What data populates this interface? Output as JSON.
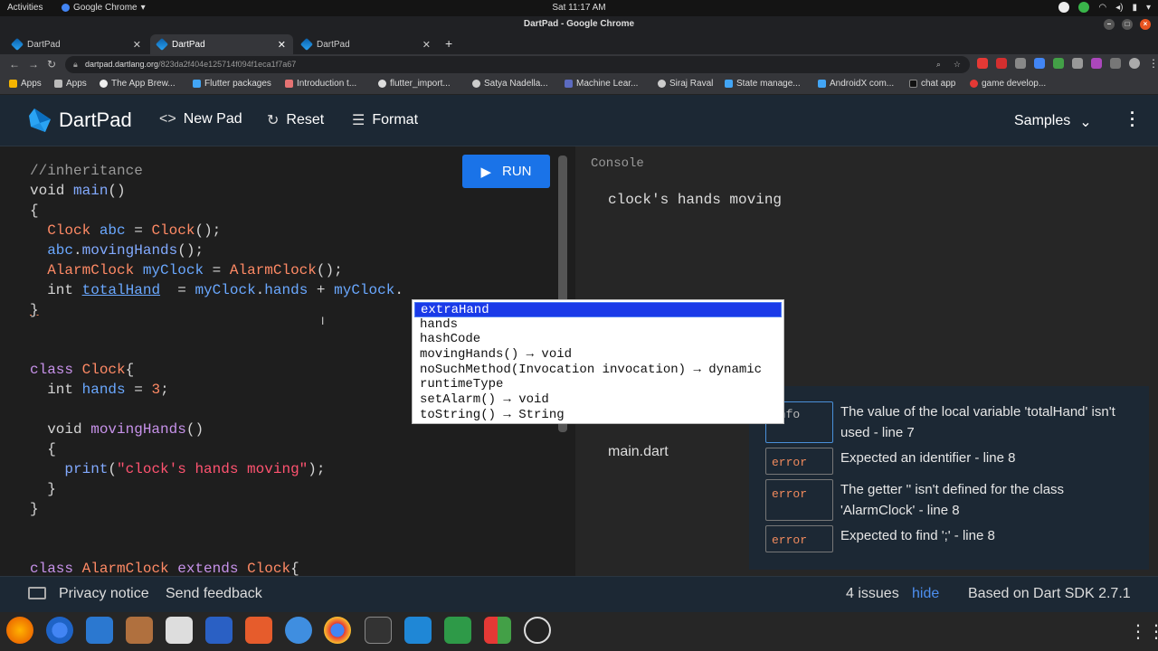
{
  "gnome": {
    "activities": "Activities",
    "app": "Google Chrome",
    "clock": "Sat 11:17 AM"
  },
  "window": {
    "title": "DartPad - Google Chrome"
  },
  "tabs": [
    {
      "label": "DartPad"
    },
    {
      "label": "DartPad"
    },
    {
      "label": "DartPad"
    }
  ],
  "omnibox": {
    "host": "dartpad.dartlang.org",
    "path": "/823da2f404e125714f094f1eca1f7a67"
  },
  "bookmarks": [
    "Apps",
    "Apps",
    "The App Brew...",
    "Flutter packages",
    "Introduction t...",
    "flutter_import...",
    "Satya Nadella...",
    "Machine Lear...",
    "Siraj Raval",
    "State manage...",
    "AndroidX com...",
    "chat app",
    "game develop..."
  ],
  "header": {
    "title": "DartPad",
    "new_pad": "New Pad",
    "reset": "Reset",
    "format": "Format",
    "samples": "Samples"
  },
  "run": {
    "label": "RUN"
  },
  "code": {
    "l1": "//inheritance",
    "l2a": "void",
    "l2b": "main",
    "l2c": "()",
    "l3": "{",
    "l4a": "Clock",
    "l4b": "abc",
    "l4c": " = ",
    "l4d": "Clock",
    "l4e": "();",
    "l5a": "abc",
    "l5b": ".",
    "l5c": "movingHands",
    "l5d": "();",
    "l6a": "AlarmClock",
    "l6b": "myClock",
    "l6c": " = ",
    "l6d": "AlarmClock",
    "l6e": "();",
    "l7a": "int",
    "l7b": "totalHand",
    "l7c": "  = ",
    "l7d": "myClock",
    "l7e": ".",
    "l7f": "hands",
    "l7g": " + ",
    "l7h": "myClock",
    "l7i": ".",
    "l8": "}",
    "l11a": "class",
    "l11b": "Clock",
    "l11c": "{",
    "l12a": "int",
    "l12b": "hands",
    "l12c": " = ",
    "l12d": "3",
    "l12e": ";",
    "l14a": "void",
    "l14b": "movingHands",
    "l14c": "()",
    "l15": "{",
    "l16a": "print",
    "l16b": "(",
    "l16c": "\"clock's hands moving\"",
    "l16d": ");",
    "l17": "}",
    "l18": "}",
    "l21a": "class",
    "l21b": "AlarmClock",
    "l21c": "extends",
    "l21d": "Clock",
    "l21e": "{"
  },
  "autocomplete": [
    "extraHand",
    "hands",
    "hashCode",
    "movingHands() → void",
    "noSuchMethod(Invocation invocation) → dynamic",
    "runtimeType",
    "setAlarm() → void",
    "toString() → String"
  ],
  "console": {
    "label": "Console",
    "output": "clock's hands moving",
    "file": "main.dart"
  },
  "issues": [
    {
      "kind": "info",
      "text": "The value of the local variable 'totalHand' isn't used - line 7"
    },
    {
      "kind": "error",
      "text": "Expected an identifier - line 8"
    },
    {
      "kind": "error",
      "text": "The getter '' isn't defined for the class 'AlarmClock' - line 8"
    },
    {
      "kind": "error",
      "text": "Expected to find ';' - line 8"
    }
  ],
  "footer": {
    "privacy": "Privacy notice",
    "feedback": "Send feedback",
    "issue_count": "4 issues",
    "hide": "hide",
    "sdk": "Based on Dart SDK 2.7.1"
  },
  "colors": {
    "accent": "#1a73e8",
    "header_bg": "#1c2834",
    "error": "#f08a5d",
    "link": "#4d8ff0"
  }
}
